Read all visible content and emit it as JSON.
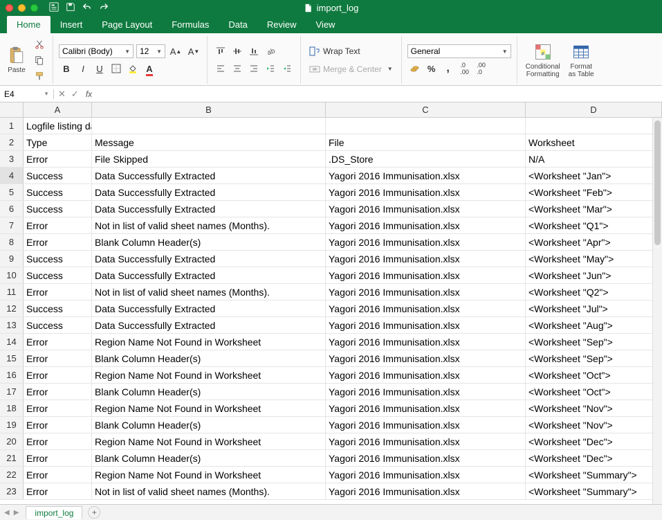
{
  "title": "import_log",
  "tabs": [
    "Home",
    "Insert",
    "Page Layout",
    "Formulas",
    "Data",
    "Review",
    "View"
  ],
  "activeTab": 0,
  "paste_label": "Paste",
  "font_name": "Calibri (Body)",
  "font_size": "12",
  "wrap_label": "Wrap Text",
  "merge_label": "Merge & Center",
  "number_format": "General",
  "cond_fmt_label": "Conditional\nFormatting",
  "fmt_table_label": "Format\nas Table",
  "namebox": "E4",
  "fx_label": "fx",
  "columns": [
    "A",
    "B",
    "C",
    "D"
  ],
  "rows": [
    {
      "n": "1",
      "type": "Logfile listing data import errors",
      "msg": "",
      "file": "",
      "ws": ""
    },
    {
      "n": "2",
      "type": "Type",
      "msg": "Message",
      "file": "File",
      "ws": "Worksheet"
    },
    {
      "n": "3",
      "type": "Error",
      "msg": "File Skipped",
      "file": ".DS_Store",
      "ws": "N/A"
    },
    {
      "n": "4",
      "type": "Success",
      "msg": "Data Successfully Extracted",
      "file": "Yagori 2016 Immunisation.xlsx",
      "ws": "<Worksheet \"Jan\">"
    },
    {
      "n": "5",
      "type": "Success",
      "msg": "Data Successfully Extracted",
      "file": "Yagori 2016 Immunisation.xlsx",
      "ws": "<Worksheet \"Feb\">"
    },
    {
      "n": "6",
      "type": "Success",
      "msg": "Data Successfully Extracted",
      "file": "Yagori 2016 Immunisation.xlsx",
      "ws": "<Worksheet \"Mar\">"
    },
    {
      "n": "7",
      "type": "Error",
      "msg": "Not in list of valid sheet names (Months).",
      "file": "Yagori 2016 Immunisation.xlsx",
      "ws": "<Worksheet \"Q1\">"
    },
    {
      "n": "8",
      "type": "Error",
      "msg": "Blank Column Header(s)",
      "file": "Yagori 2016 Immunisation.xlsx",
      "ws": "<Worksheet \"Apr\">"
    },
    {
      "n": "9",
      "type": "Success",
      "msg": "Data Successfully Extracted",
      "file": "Yagori 2016 Immunisation.xlsx",
      "ws": "<Worksheet \"May\">"
    },
    {
      "n": "10",
      "type": "Success",
      "msg": "Data Successfully Extracted",
      "file": "Yagori 2016 Immunisation.xlsx",
      "ws": "<Worksheet \"Jun\">"
    },
    {
      "n": "11",
      "type": "Error",
      "msg": "Not in list of valid sheet names (Months).",
      "file": "Yagori 2016 Immunisation.xlsx",
      "ws": "<Worksheet \"Q2\">"
    },
    {
      "n": "12",
      "type": "Success",
      "msg": "Data Successfully Extracted",
      "file": "Yagori 2016 Immunisation.xlsx",
      "ws": "<Worksheet \"Jul\">"
    },
    {
      "n": "13",
      "type": "Success",
      "msg": "Data Successfully Extracted",
      "file": "Yagori 2016 Immunisation.xlsx",
      "ws": "<Worksheet \"Aug\">"
    },
    {
      "n": "14",
      "type": "Error",
      "msg": "Region Name Not Found in Worksheet",
      "file": "Yagori 2016 Immunisation.xlsx",
      "ws": "<Worksheet \"Sep\">"
    },
    {
      "n": "15",
      "type": "Error",
      "msg": "Blank Column Header(s)",
      "file": "Yagori 2016 Immunisation.xlsx",
      "ws": "<Worksheet \"Sep\">"
    },
    {
      "n": "16",
      "type": "Error",
      "msg": "Region Name Not Found in Worksheet",
      "file": "Yagori 2016 Immunisation.xlsx",
      "ws": "<Worksheet \"Oct\">"
    },
    {
      "n": "17",
      "type": "Error",
      "msg": "Blank Column Header(s)",
      "file": "Yagori 2016 Immunisation.xlsx",
      "ws": "<Worksheet \"Oct\">"
    },
    {
      "n": "18",
      "type": "Error",
      "msg": "Region Name Not Found in Worksheet",
      "file": "Yagori 2016 Immunisation.xlsx",
      "ws": "<Worksheet \"Nov\">"
    },
    {
      "n": "19",
      "type": "Error",
      "msg": "Blank Column Header(s)",
      "file": "Yagori 2016 Immunisation.xlsx",
      "ws": "<Worksheet \"Nov\">"
    },
    {
      "n": "20",
      "type": "Error",
      "msg": "Region Name Not Found in Worksheet",
      "file": "Yagori 2016 Immunisation.xlsx",
      "ws": "<Worksheet \"Dec\">"
    },
    {
      "n": "21",
      "type": "Error",
      "msg": "Blank Column Header(s)",
      "file": "Yagori 2016 Immunisation.xlsx",
      "ws": "<Worksheet \"Dec\">"
    },
    {
      "n": "22",
      "type": "Error",
      "msg": "Region Name Not Found in Worksheet",
      "file": "Yagori 2016 Immunisation.xlsx",
      "ws": "<Worksheet \"Summary\">"
    },
    {
      "n": "23",
      "type": "Error",
      "msg": "Not in list of valid sheet names (Months).",
      "file": "Yagori 2016 Immunisation.xlsx",
      "ws": "<Worksheet \"Summary\">"
    }
  ],
  "sheet_tab": "import_log"
}
